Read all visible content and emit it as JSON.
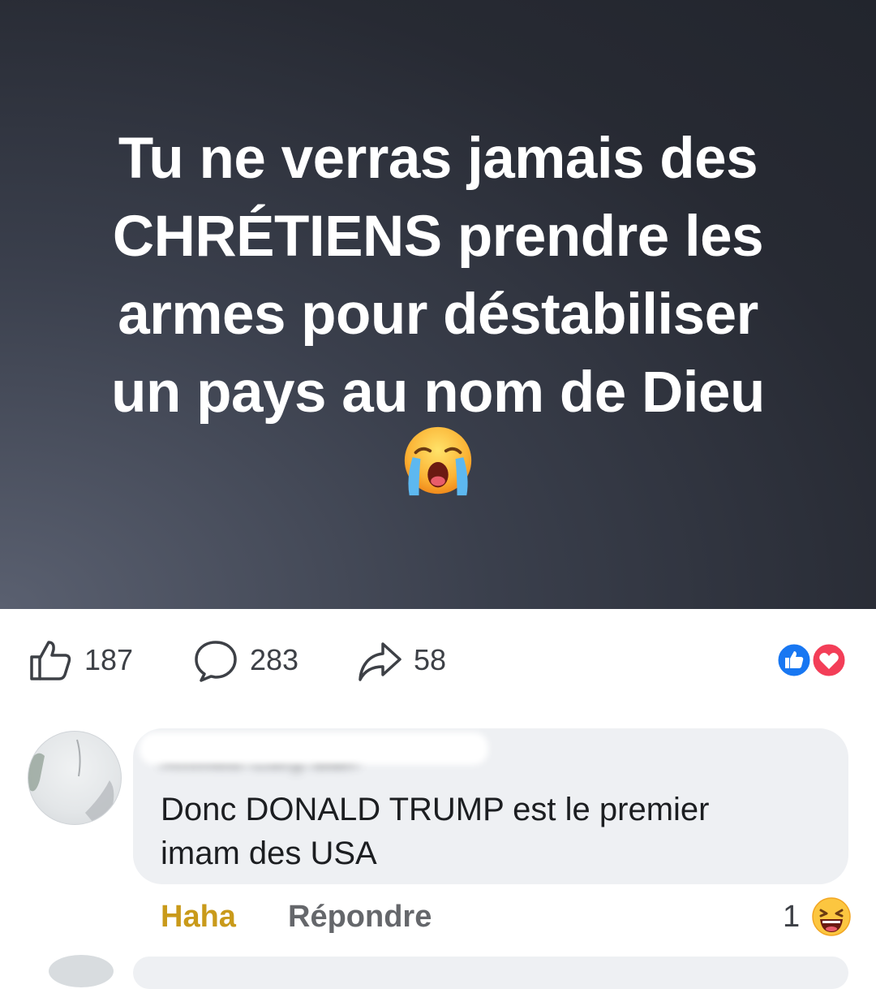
{
  "post": {
    "lines": [
      "Tu ne verras jamais des",
      "CHRÉTIENS prendre les",
      "armes pour déstabiliser",
      "un pays au nom de Dieu"
    ],
    "emoji": "crying-face-emoji"
  },
  "stats": {
    "likes": "187",
    "comments": "283",
    "shares": "58",
    "reactions": [
      "like-reaction-icon",
      "love-reaction-icon"
    ]
  },
  "comment": {
    "author": "Ahmed Cury Bah",
    "text_lines": [
      "Donc DONALD TRUMP est le premier",
      "imam des USA"
    ],
    "actions": {
      "haha_label": "Haha",
      "reply_label": "Répondre"
    },
    "reaction_count": "1",
    "reaction_emoji": "grinning-squinting-face-emoji"
  },
  "colors": {
    "post_background": "#2a2d36",
    "post_text": "#ffffff",
    "haha_color": "#c99a1a",
    "bubble_background": "#eef0f3",
    "like_blue": "#1877f2",
    "love_red": "#f33e58"
  }
}
